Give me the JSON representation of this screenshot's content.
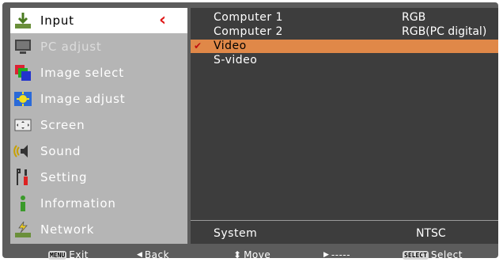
{
  "sidebar": {
    "items": [
      {
        "label": "Input",
        "icon": "input-icon"
      },
      {
        "label": "PC adjust",
        "icon": "pc-adjust-icon"
      },
      {
        "label": "Image select",
        "icon": "image-select-icon"
      },
      {
        "label": "Image adjust",
        "icon": "image-adjust-icon"
      },
      {
        "label": "Screen",
        "icon": "screen-icon"
      },
      {
        "label": "Sound",
        "icon": "sound-icon"
      },
      {
        "label": "Setting",
        "icon": "setting-icon"
      },
      {
        "label": "Information",
        "icon": "information-icon"
      },
      {
        "label": "Network",
        "icon": "network-icon"
      }
    ],
    "active_marker": "‹"
  },
  "main": {
    "rows": [
      {
        "name": "Computer 1",
        "value": "RGB"
      },
      {
        "name": "Computer 2",
        "value": "RGB(PC digital)"
      },
      {
        "name": "Video",
        "value": "",
        "check": "✔"
      },
      {
        "name": "S-video",
        "value": ""
      }
    ],
    "system": {
      "label": "System",
      "value": "NTSC"
    }
  },
  "footer": {
    "exit": {
      "key": "MENU",
      "label": "Exit"
    },
    "back": {
      "symbol": "◀",
      "label": "Back"
    },
    "move": {
      "symbol": "⬍",
      "label": "Move"
    },
    "next": {
      "symbol": "▶",
      "label": "-----"
    },
    "select": {
      "key": "SELECT",
      "label": "Select"
    }
  },
  "colors": {
    "frame": "#5c5c5c",
    "sidebar": "#b5b5b5",
    "panel": "#3d3d3d",
    "selected_row": "#e08848",
    "active_marker": "#e01818"
  }
}
